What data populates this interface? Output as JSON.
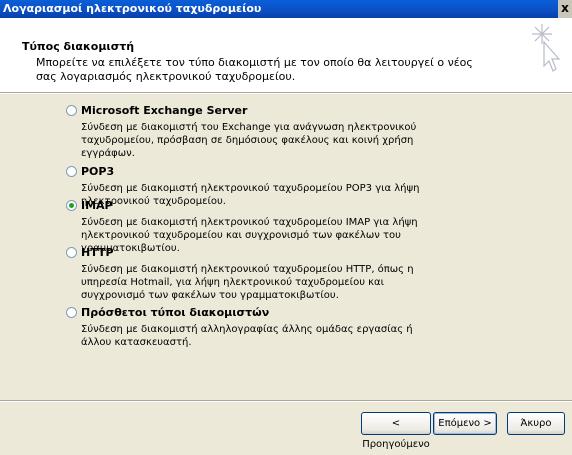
{
  "window": {
    "title": "Λογαριασμοί ηλεκτρονικού ταχυδρομείου",
    "close_label": "x"
  },
  "header": {
    "title": "Τύπος διακομιστή",
    "description": "Μπορείτε να επιλέξετε τον τύπο διακομιστή με τον οποίο θα λειτουργεί ο νέος σας λογαριασμός ηλεκτρονικού ταχυδρομείου."
  },
  "options": [
    {
      "label": "Microsoft Exchange Server",
      "checked": false,
      "description": "Σύνδεση με διακομιστή του Exchange για ανάγνωση ηλεκτρονικού ταχυδρομείου, πρόσβαση σε δημόσιους φακέλους και κοινή χρήση εγγράφων."
    },
    {
      "label": "POP3",
      "checked": false,
      "description": "Σύνδεση με διακομιστή ηλεκτρονικού ταχυδρομείου POP3 για λήψη ηλεκτρονικού ταχυδρομείου."
    },
    {
      "label": "IMAP",
      "checked": true,
      "description": "Σύνδεση με διακομιστή ηλεκτρονικού ταχυδρομείου IMAP για λήψη ηλεκτρονικού ταχυδρομείου και συγχρονισμό των φακέλων του γραμματοκιβωτίου."
    },
    {
      "label": "HTTP",
      "checked": false,
      "description": "Σύνδεση με διακομιστή ηλεκτρονικού ταχυδρομείου HTTP, όπως η υπηρεσία Hotmail, για λήψη ηλεκτρονικού ταχυδρομείου και συγχρονισμό των φακέλων του γραμματοκιβωτίου."
    },
    {
      "label": "Πρόσθετοι τύποι διακομιστών",
      "checked": false,
      "description": "Σύνδεση με διακομιστή αλληλογραφίας άλλης ομάδας εργασίας ή άλλου κατασκευαστή."
    }
  ],
  "buttons": {
    "back": "< Προηγούμενο",
    "next": "Επόμενο >",
    "cancel": "Άκυρο"
  },
  "colors": {
    "titlebar": "#0b4fc4",
    "dialog_bg": "#ece9d8",
    "radio_dot": "#21a121"
  }
}
